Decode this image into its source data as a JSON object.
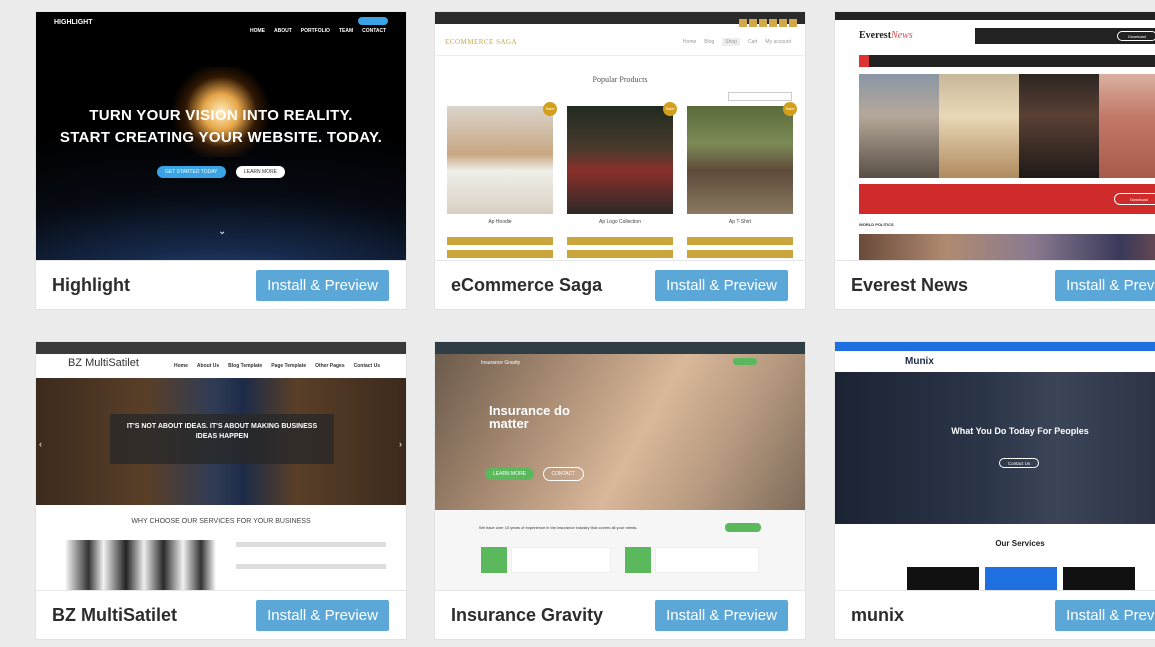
{
  "install_label": "Install & Preview",
  "themes": [
    {
      "name": "Highlight",
      "preview": {
        "logo": "HIGHLIGHT",
        "nav": [
          "HOME",
          "ABOUT",
          "PORTFOLIO",
          "TEAM",
          "CONTACT"
        ],
        "headline_line1": "TURN YOUR VISION INTO REALITY.",
        "headline_line2": "START CREATING YOUR WEBSITE. TODAY.",
        "btn_primary": "GET STARTED TODAY",
        "btn_secondary": "LEARN MORE"
      }
    },
    {
      "name": "eCommerce Saga",
      "preview": {
        "logo": "ECOMMERCE SAGA",
        "nav": [
          "Home",
          "Blog",
          "Shop",
          "Cart",
          "My account"
        ],
        "section_title": "Popular Products",
        "products": [
          {
            "name": "Ap Hoodie",
            "sale": "Sale!"
          },
          {
            "name": "Ap Logo Collection",
            "sale": "Sale!"
          },
          {
            "name": "Ap T-Shirt",
            "sale": "Sale!"
          }
        ]
      }
    },
    {
      "name": "Everest News",
      "preview": {
        "logo_main": "Everest",
        "logo_accent": "News",
        "download": "Download",
        "section": "WORLD POLITICS"
      }
    },
    {
      "name": "BZ MultiSatilet",
      "preview": {
        "logo": "BZ MultiSatilet",
        "nav": [
          "Home",
          "About Us",
          "Blog Template",
          "Page Template",
          "Other Pages",
          "Contact Us"
        ],
        "hero_line1": "IT'S NOT ABOUT IDEAS. IT'S ABOUT MAKING BUSINESS",
        "hero_line2": "IDEAS HAPPEN",
        "section_title": "WHY CHOOSE OUR SERVICES FOR YOUR BUSINESS"
      }
    },
    {
      "name": "Insurance Gravity",
      "preview": {
        "logo": "Insurance Gravity",
        "headline_line1": "Insurance do",
        "headline_line2": "matter",
        "btn_primary": "LEARN MORE",
        "btn_secondary": "CONTACT",
        "section_text": "We have over 10 years of experience in the insurance industry that covers all your needs."
      }
    },
    {
      "name": "munix",
      "preview": {
        "logo": "Munix",
        "headline": "What You Do Today For Peoples",
        "btn": "Contact Us",
        "section_title": "Our Services"
      }
    }
  ]
}
